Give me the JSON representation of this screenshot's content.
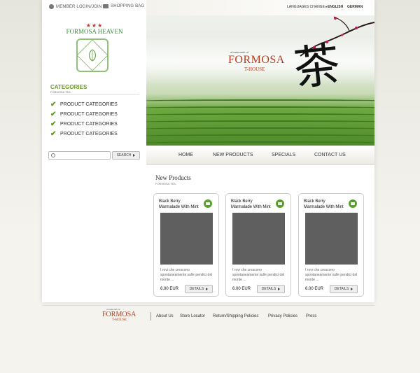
{
  "topbar": {
    "member_login": "MEMBER LOGIN/JOIN",
    "shopping_bag": "SHOPPING BAG",
    "languages_change": "LANGUAGES CHANGE ▸",
    "english": "ENGLISH",
    "german": "GERMAN"
  },
  "logo": {
    "stars": "★★★",
    "text": "FORMOSA HEAVEN"
  },
  "categories": {
    "title": "CATEGORIES",
    "subtitle": "FORMOSA TEA",
    "items": [
      "PRODUCT CATEGORIES",
      "PRODUCT CATEGORIES",
      "PRODUCT CATEGORIES",
      "PRODUCT CATEGORIES"
    ]
  },
  "search": {
    "button_label": "SEARCH"
  },
  "banner": {
    "small": "a trademark of",
    "name": "FORMOSA",
    "sub": "T-HOUSE",
    "character": "茶"
  },
  "nav": {
    "home": "HOME",
    "new_products": "NEW PRODUCTS",
    "specials": "SPECIALS",
    "contact": "CONTACT US"
  },
  "new_products": {
    "title": "New Products",
    "subtitle": "FORMOSA TEA",
    "cards": [
      {
        "name": "Black Berry Marmalade With Mint",
        "desc": "I rovi che crescono spontaneamente sulle pendici del monte ...",
        "price": "6.00 EUR",
        "button": "DETAILS"
      },
      {
        "name": "Black Berry Marmalade With Mint",
        "desc": "I rovi che crescono spontaneamente sulle pendici del monte ...",
        "price": "6.00 EUR",
        "button": "DETAILS"
      },
      {
        "name": "Black Berry Marmalade With Mint",
        "desc": "I rovi che crescono spontaneamente sulle pendici del monte ...",
        "price": "6.00 EUR",
        "button": "DETAILS"
      }
    ]
  },
  "footer": {
    "brand_small": "a trademark of",
    "brand": "FORMOSA",
    "brand_sub": "T-HOUSE",
    "links": [
      "About Us",
      "Store Locator",
      "Return/Shipping Policies",
      "Privacy Policies",
      "Press"
    ]
  },
  "colors": {
    "accent_green": "#5a9a1a",
    "brand_red": "#b53b1d"
  }
}
